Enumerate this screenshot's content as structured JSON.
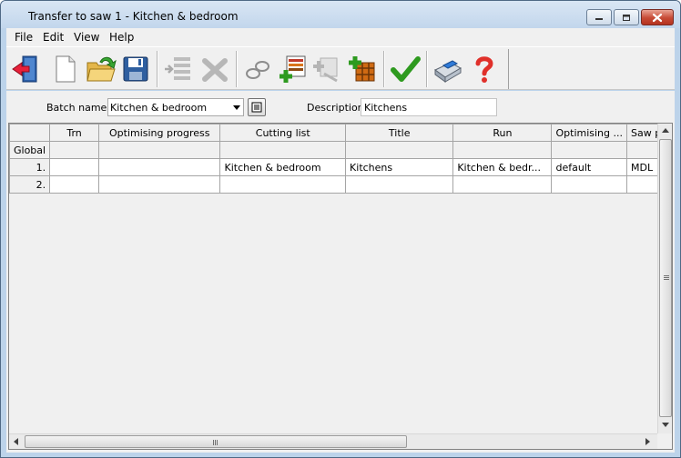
{
  "window": {
    "title": "Transfer to saw 1 - Kitchen & bedroom"
  },
  "menu": {
    "items": [
      {
        "label": "File"
      },
      {
        "label": "Edit"
      },
      {
        "label": "View"
      },
      {
        "label": "Help"
      }
    ]
  },
  "toolbar": {
    "icons": [
      "exit-icon",
      "new-document-icon",
      "open-folder-icon",
      "save-disk-icon",
      "insert-row-icon",
      "delete-icon",
      "link-icon",
      "add-cutting-list-icon",
      "edit-cutting-list-icon",
      "add-board-icon",
      "confirm-check-icon",
      "print-icon",
      "help-icon"
    ]
  },
  "form": {
    "batch_name_label": "Batch name",
    "batch_name_value": "Kitchen & bedroom",
    "description_label": "Description",
    "description_value": "Kitchens"
  },
  "grid": {
    "columns": [
      "",
      "Trn",
      "Optimising progress",
      "Cutting list",
      "Title",
      "Run",
      "Optimising ...",
      "Saw pa"
    ],
    "rows": [
      {
        "head": "Global",
        "cells": [
          "",
          "",
          "",
          "",
          "",
          "",
          ""
        ]
      },
      {
        "head": "1.",
        "cells": [
          "",
          "",
          "Kitchen & bedroom",
          "Kitchens",
          "Kitchen & bedr...",
          "default",
          "MDL"
        ]
      },
      {
        "head": "2.",
        "cells": [
          "",
          "",
          "",
          "",
          "",
          "",
          ""
        ]
      }
    ]
  },
  "colors": {
    "title_bar": "#c2d6ec",
    "close_button": "#c74a35",
    "check_icon": "#2e9a1f",
    "help_icon": "#e0302a"
  }
}
